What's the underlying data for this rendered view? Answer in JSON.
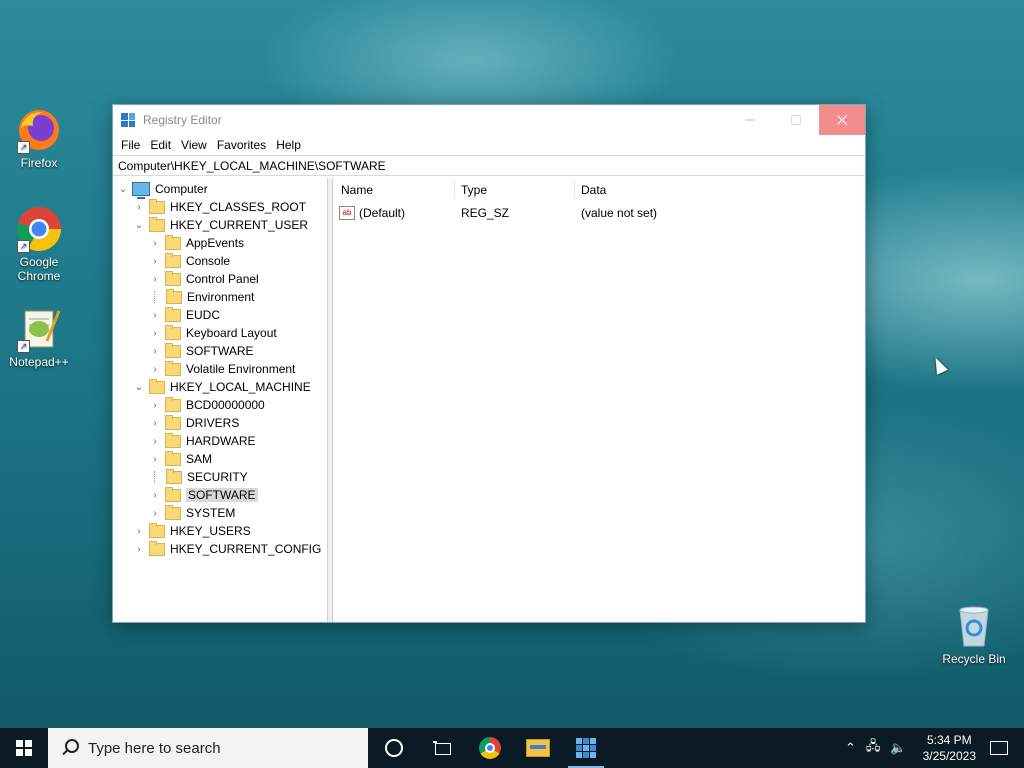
{
  "desktop": {
    "icons": [
      {
        "label": "Firefox",
        "icon": "firefox-icon"
      },
      {
        "label": "Google Chrome",
        "icon": "chrome-icon"
      },
      {
        "label": "Notepad++",
        "icon": "notepad-plus-plus-icon"
      },
      {
        "label": "Recycle Bin",
        "icon": "recycle-bin-icon"
      }
    ]
  },
  "window": {
    "title": "Registry Editor",
    "menu": [
      "File",
      "Edit",
      "View",
      "Favorites",
      "Help"
    ],
    "address": "Computer\\HKEY_LOCAL_MACHINE\\SOFTWARE",
    "tree": [
      {
        "label": "Computer",
        "expanded": true
      },
      {
        "label": "HKEY_CLASSES_ROOT"
      },
      {
        "label": "HKEY_CURRENT_USER",
        "expanded": true
      },
      {
        "label": "AppEvents"
      },
      {
        "label": "Console"
      },
      {
        "label": "Control Panel"
      },
      {
        "label": "Environment"
      },
      {
        "label": "EUDC"
      },
      {
        "label": "Keyboard Layout"
      },
      {
        "label": "SOFTWARE"
      },
      {
        "label": "Volatile Environment"
      },
      {
        "label": "HKEY_LOCAL_MACHINE",
        "expanded": true
      },
      {
        "label": "BCD00000000"
      },
      {
        "label": "DRIVERS"
      },
      {
        "label": "HARDWARE"
      },
      {
        "label": "SAM"
      },
      {
        "label": "SECURITY"
      },
      {
        "label": "SOFTWARE",
        "selected": true
      },
      {
        "label": "SYSTEM"
      },
      {
        "label": "HKEY_USERS"
      },
      {
        "label": "HKEY_CURRENT_CONFIG"
      }
    ],
    "columns": {
      "name": "Name",
      "type": "Type",
      "data": "Data"
    },
    "rows": [
      {
        "name": "(Default)",
        "type": "REG_SZ",
        "data": "(value not set)"
      }
    ]
  },
  "taskbar": {
    "search_placeholder": "Type here to search",
    "time": "5:34 PM",
    "date": "3/25/2023"
  }
}
